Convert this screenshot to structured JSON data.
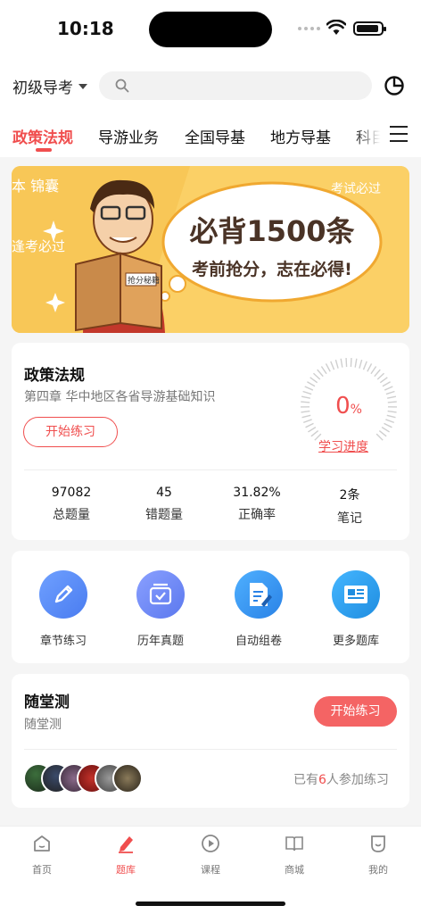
{
  "status": {
    "time": "10:18"
  },
  "header": {
    "level_label": "初级导考",
    "search_placeholder": "",
    "icons": [
      "chevron-down-icon",
      "search-icon",
      "pie-chart-icon"
    ]
  },
  "tabs": [
    {
      "label": "政策法规",
      "active": true
    },
    {
      "label": "导游业务",
      "active": false
    },
    {
      "label": "全国导基",
      "active": false
    },
    {
      "label": "地方导基",
      "active": false
    },
    {
      "label": "科目",
      "active": false
    }
  ],
  "banner": {
    "headline": "必背1500条",
    "slogan": "考前抢分，志在必得!",
    "book_text": "抢分秘籍",
    "bg_text_left": "本  锦囊",
    "bg_text_right": "考试必过",
    "bg_text_mid": "逢考必过",
    "colors": {
      "background": "#fbd066",
      "accent": "#c2372b"
    }
  },
  "policy": {
    "title": "政策法规",
    "chapter": "第四章  华中地区各省导游基础知识",
    "start_label": "开始练习",
    "progress_value": "0",
    "progress_unit": "%",
    "progress_fraction": 0,
    "progress_link": "学习进度",
    "stats": [
      {
        "value": "97082",
        "label": "总题量"
      },
      {
        "value": "45",
        "label": "错题量"
      },
      {
        "value": "31.82%",
        "label": "正确率"
      },
      {
        "value": "2条",
        "label": "笔记"
      }
    ]
  },
  "tools": [
    {
      "label": "章节练习",
      "icon": "pencil-icon",
      "color": "#5b8cf5"
    },
    {
      "label": "历年真题",
      "icon": "checked-box-icon",
      "color": "#6d86f0"
    },
    {
      "label": "自动组卷",
      "icon": "document-edit-icon",
      "color": "#3f9af0"
    },
    {
      "label": "更多题库",
      "icon": "newspaper-icon",
      "color": "#2e9ce8"
    }
  ],
  "quiz": {
    "title": "随堂测",
    "subtitle": "随堂测",
    "start_label": "开始练习",
    "participants_prefix": "已有",
    "participants_count": "6",
    "participants_suffix": "人参加练习"
  },
  "nav": [
    {
      "label": "首页",
      "icon": "home-icon",
      "active": false
    },
    {
      "label": "题库",
      "icon": "pen-icon",
      "active": true
    },
    {
      "label": "课程",
      "icon": "play-icon",
      "active": false
    },
    {
      "label": "商城",
      "icon": "book-icon",
      "active": false
    },
    {
      "label": "我的",
      "icon": "profile-icon",
      "active": false
    }
  ],
  "colors": {
    "accent": "#f04e4e",
    "page_bg": "#f5f5f5"
  }
}
